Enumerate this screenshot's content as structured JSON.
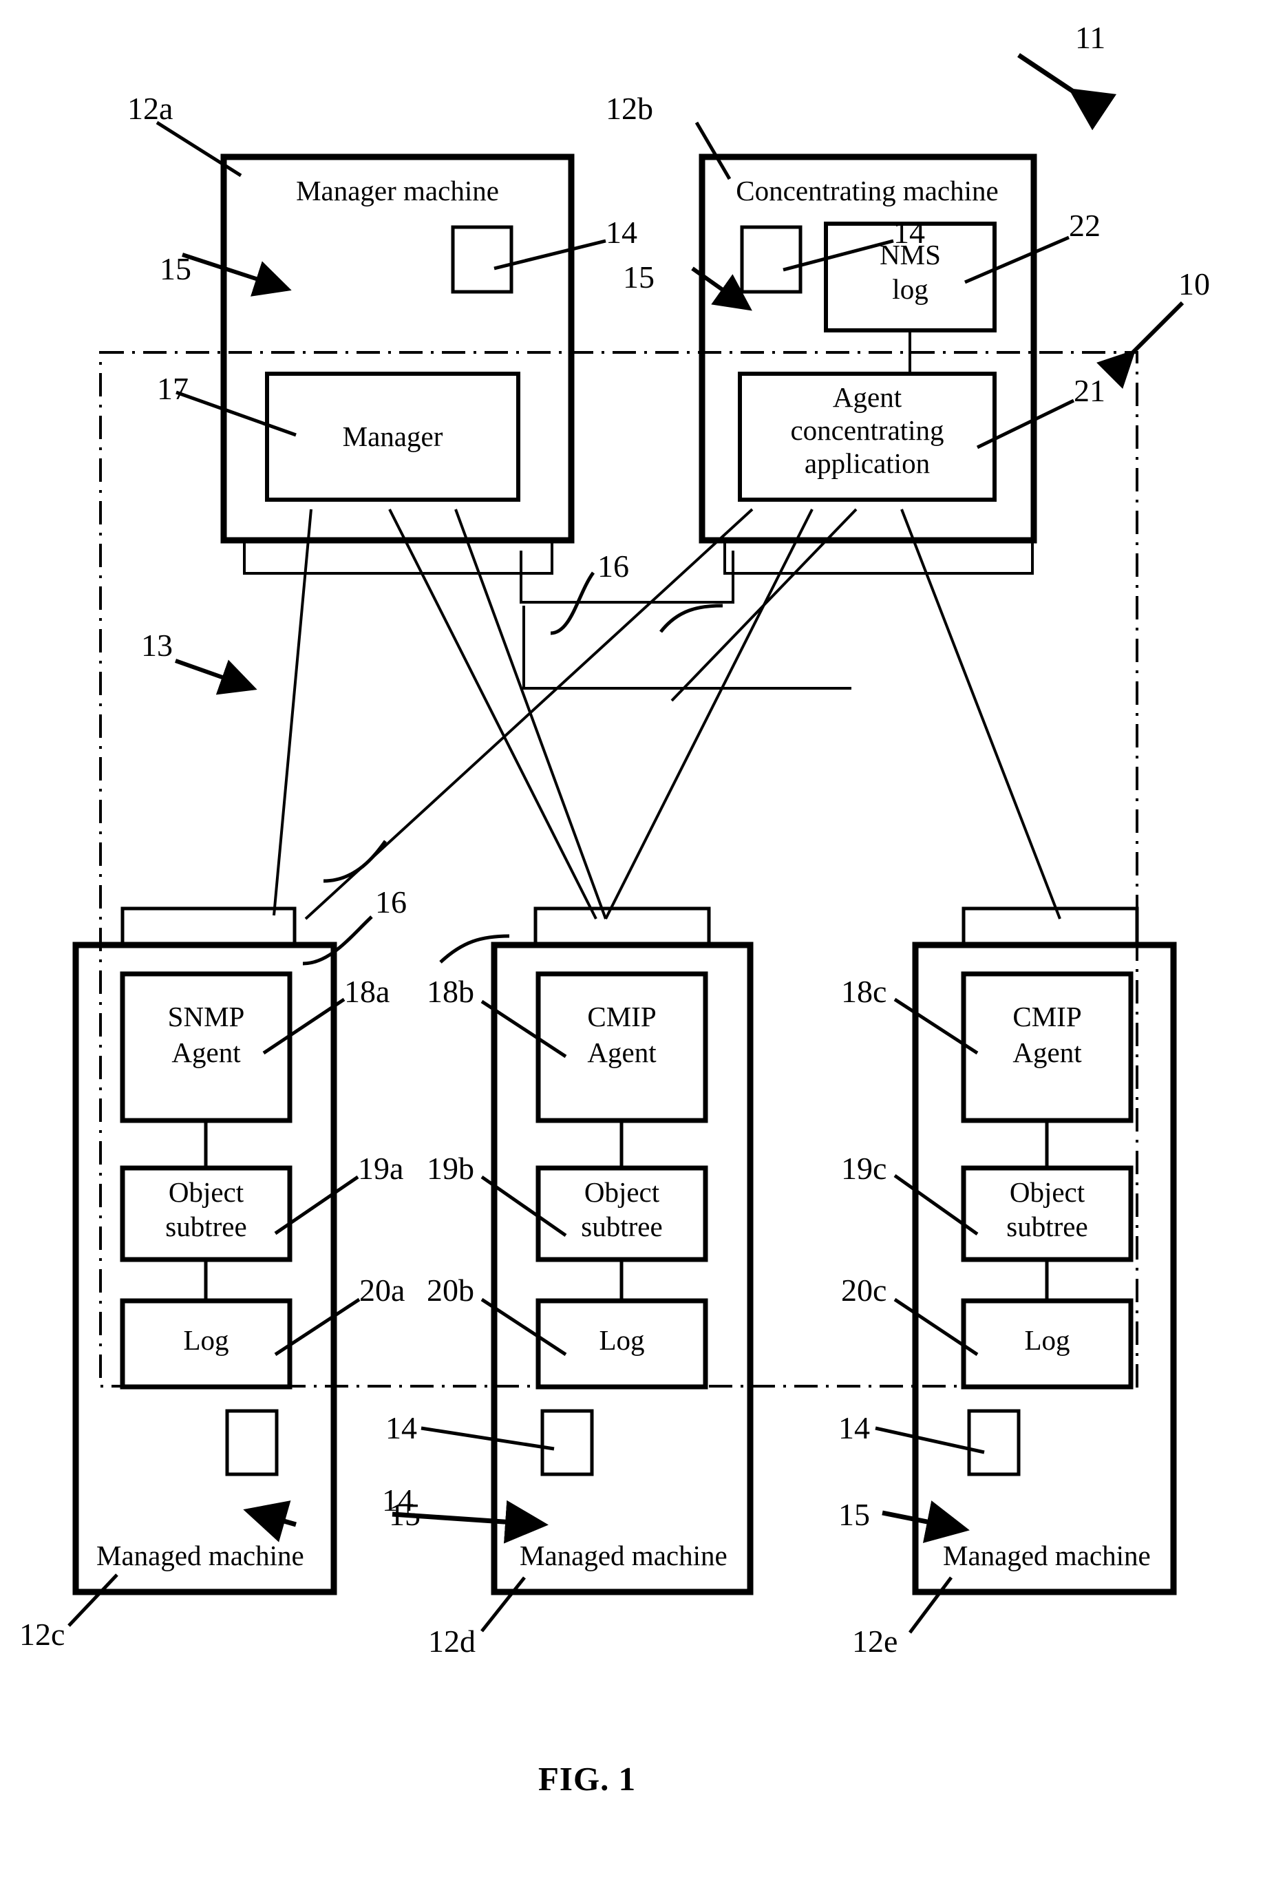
{
  "figure": {
    "caption": "FIG. 1",
    "system_ref": "11",
    "network_region_ref": "10",
    "network_ref": "13"
  },
  "machines": {
    "manager_machine": {
      "ref": "12a",
      "title": "Manager machine",
      "interface_ref": "14",
      "arrow_ref": "15",
      "network_stub_ref": "16",
      "components": [
        {
          "ref": "17",
          "label": "Manager"
        }
      ]
    },
    "concentrating_machine": {
      "ref": "12b",
      "title": "Concentrating machine",
      "interface_ref": "14",
      "arrow_ref": "15",
      "network_stub_ref": "16",
      "components": [
        {
          "ref": "22",
          "label": "NMS\nlog",
          "line1": "NMS",
          "line2": "log"
        },
        {
          "ref": "21",
          "label": "Agent concentrating application",
          "line1": "Agent",
          "line2": "concentrating",
          "line3": "application"
        }
      ]
    },
    "managed_machines": [
      {
        "ref": "12c",
        "title": "Managed machine",
        "interface_ref": "14",
        "arrow_ref": "15",
        "network_stub_ref": "16",
        "agent": {
          "ref": "18a",
          "line1": "SNMP",
          "line2": "Agent"
        },
        "object_subtree": {
          "ref": "19a",
          "line1": "Object",
          "line2": "subtree"
        },
        "log": {
          "ref": "20a",
          "label": "Log"
        }
      },
      {
        "ref": "12d",
        "title": "Managed machine",
        "interface_ref": "14",
        "arrow_ref": "15",
        "network_stub_ref": "16",
        "agent": {
          "ref": "18b",
          "line1": "CMIP",
          "line2": "Agent"
        },
        "object_subtree": {
          "ref": "19b",
          "line1": "Object",
          "line2": "subtree"
        },
        "log": {
          "ref": "20b",
          "label": "Log"
        }
      },
      {
        "ref": "12e",
        "title": "Managed machine",
        "interface_ref": "14",
        "arrow_ref": "15",
        "network_stub_ref": "16",
        "agent": {
          "ref": "18c",
          "line1": "CMIP",
          "line2": "Agent"
        },
        "object_subtree": {
          "ref": "19c",
          "line1": "Object",
          "line2": "subtree"
        },
        "log": {
          "ref": "20c",
          "label": "Log"
        }
      }
    ]
  },
  "colors": {
    "stroke": "#000000",
    "background": "#ffffff"
  }
}
